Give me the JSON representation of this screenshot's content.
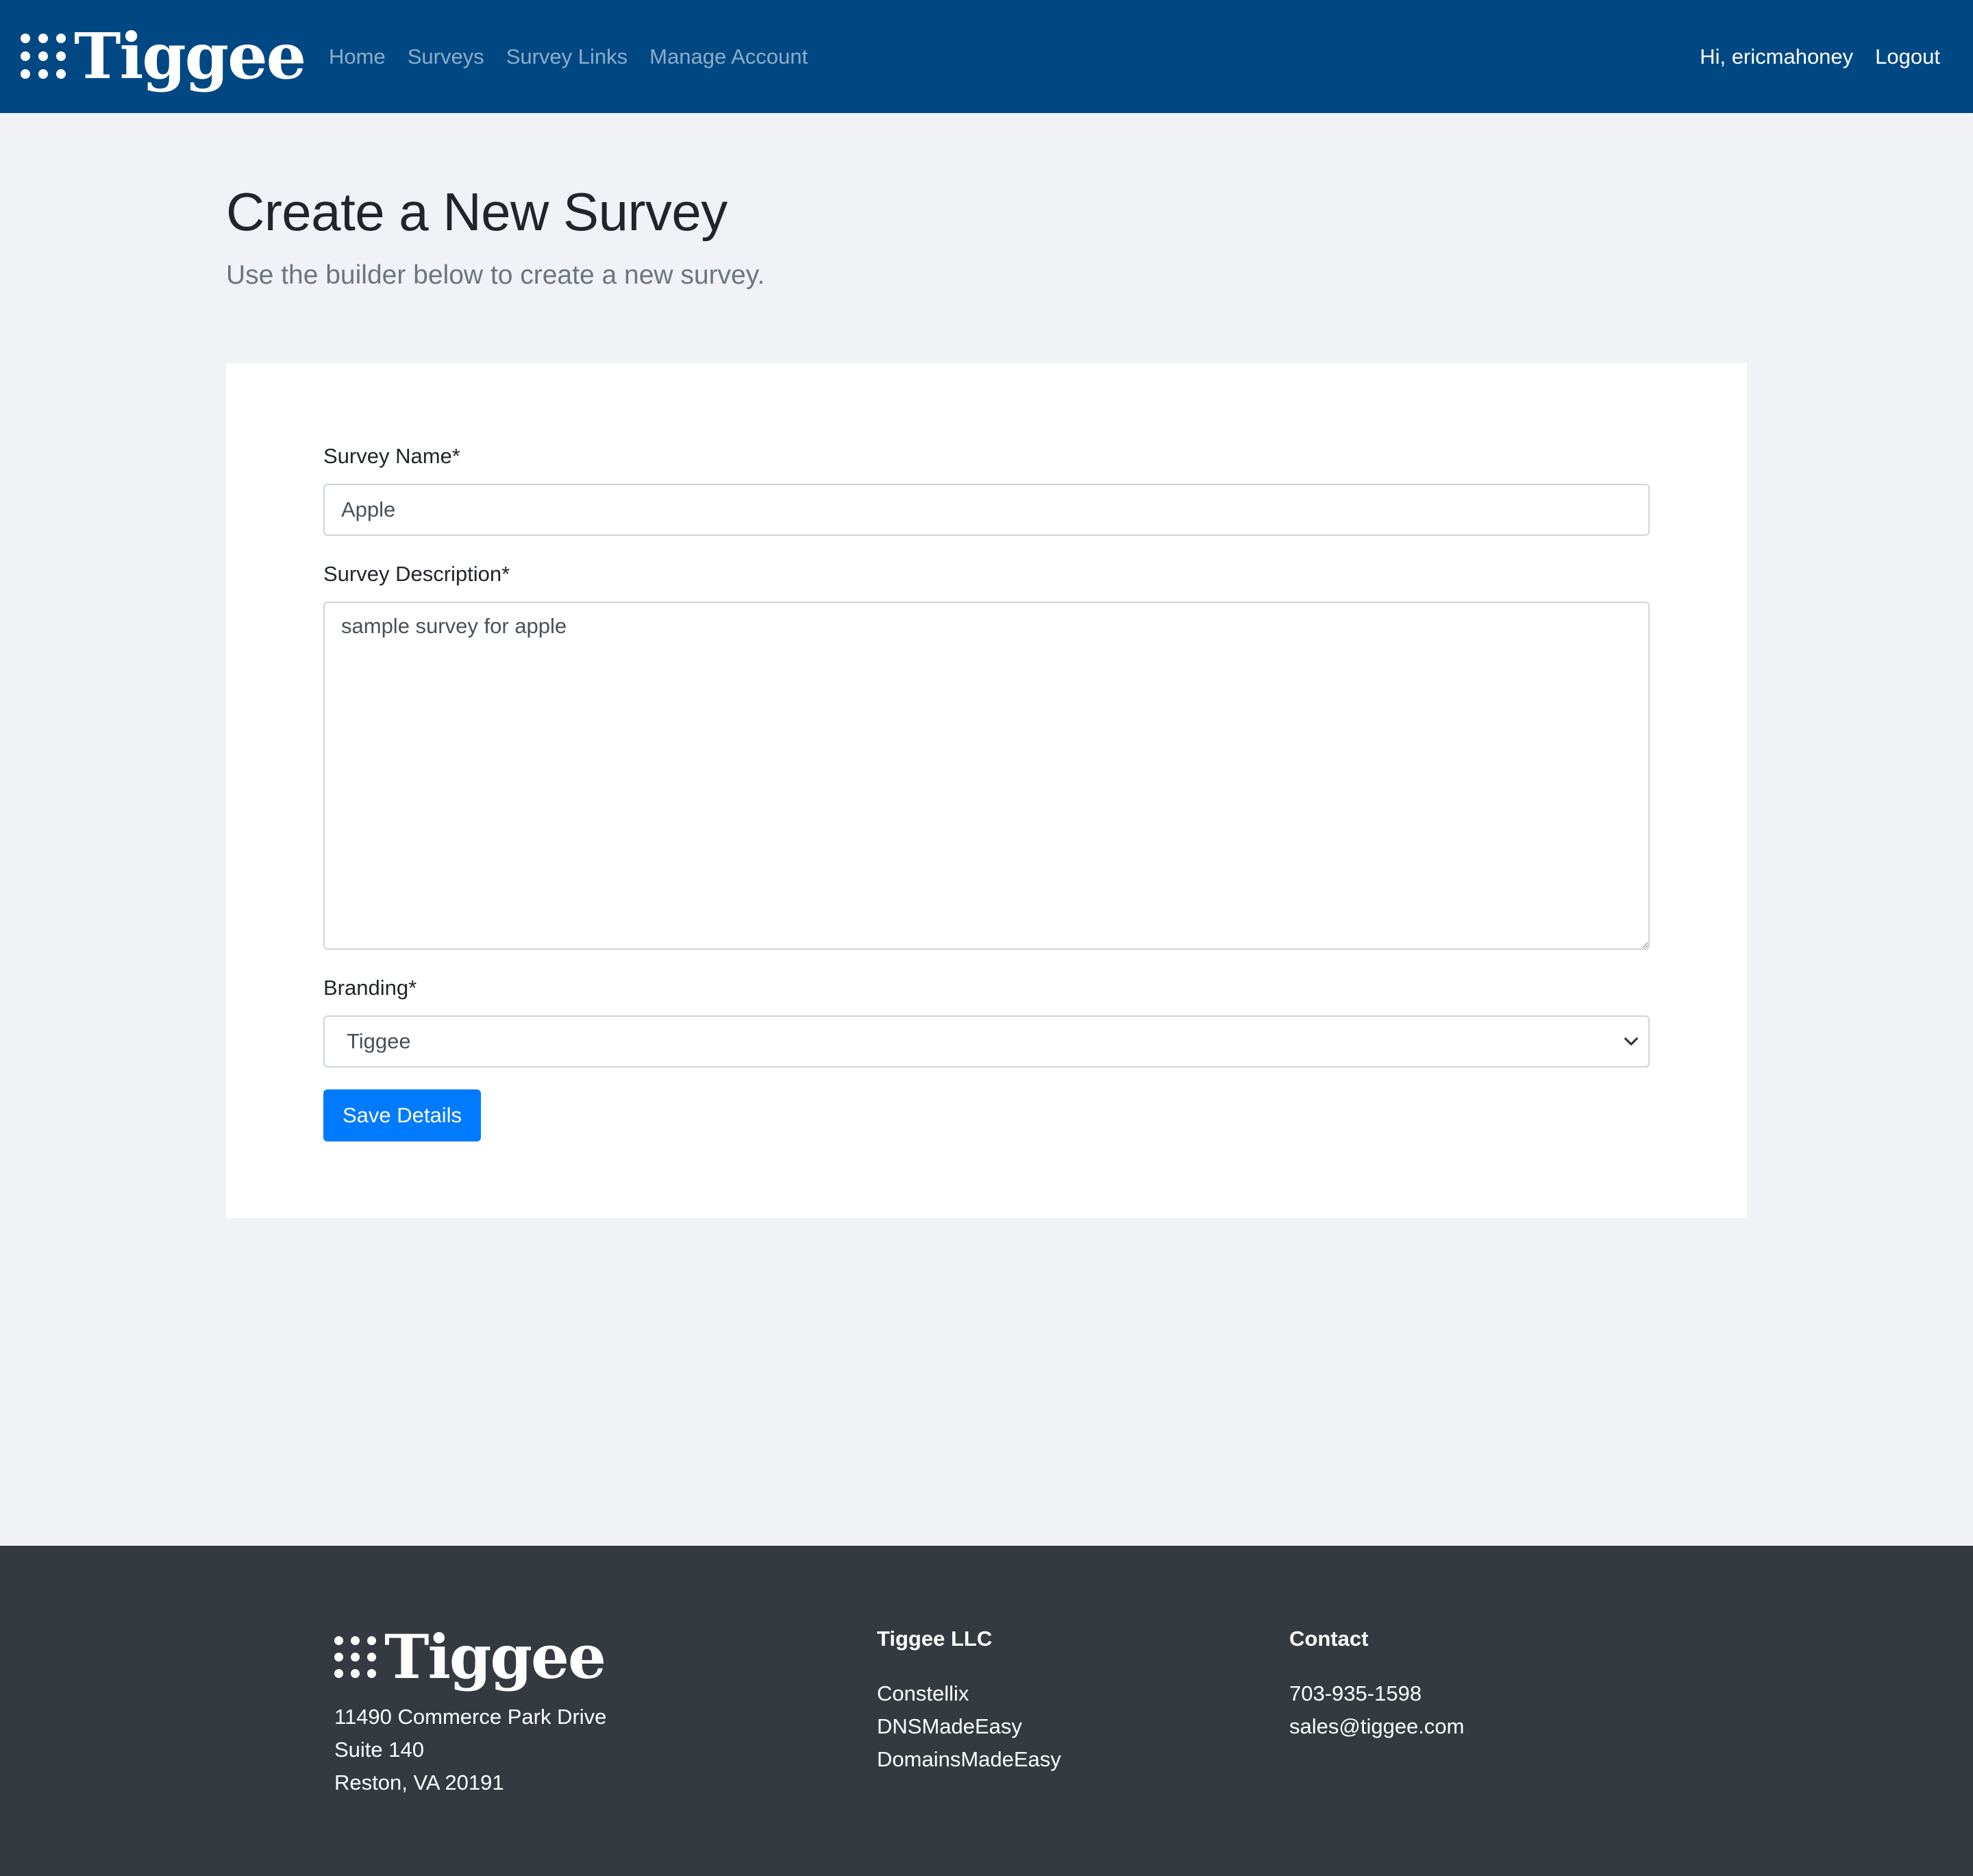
{
  "navbar": {
    "brand": "Tiggee",
    "links": [
      "Home",
      "Surveys",
      "Survey Links",
      "Manage Account"
    ],
    "greeting": "Hi, ericmahoney",
    "logout": "Logout"
  },
  "header": {
    "title": "Create a New Survey",
    "subtitle": "Use the builder below to create a new survey."
  },
  "form": {
    "name_label": "Survey Name*",
    "name_value": "Apple",
    "description_label": "Survey Description*",
    "description_value": "sample survey for apple",
    "branding_label": "Branding*",
    "branding_value": "Tiggee",
    "save_label": "Save Details"
  },
  "footer": {
    "brand": "Tiggee",
    "address": [
      "11490 Commerce Park Drive",
      "Suite 140",
      "Reston, VA 20191"
    ],
    "company_heading": "Tiggee LLC",
    "company_links": [
      "Constellix",
      "DNSMadeEasy",
      "DomainsMadeEasy"
    ],
    "contact_heading": "Contact",
    "phone": "703-935-1598",
    "email": "sales@tiggee.com"
  },
  "colors": {
    "navbar_bg": "#004884",
    "page_bg": "#f1f2f6",
    "footer_bg": "#343a40",
    "primary_button": "#007bff"
  },
  "icons": {
    "brand_logo": "dot-grid-logo-icon",
    "select_arrow": "chevron-down-icon"
  }
}
